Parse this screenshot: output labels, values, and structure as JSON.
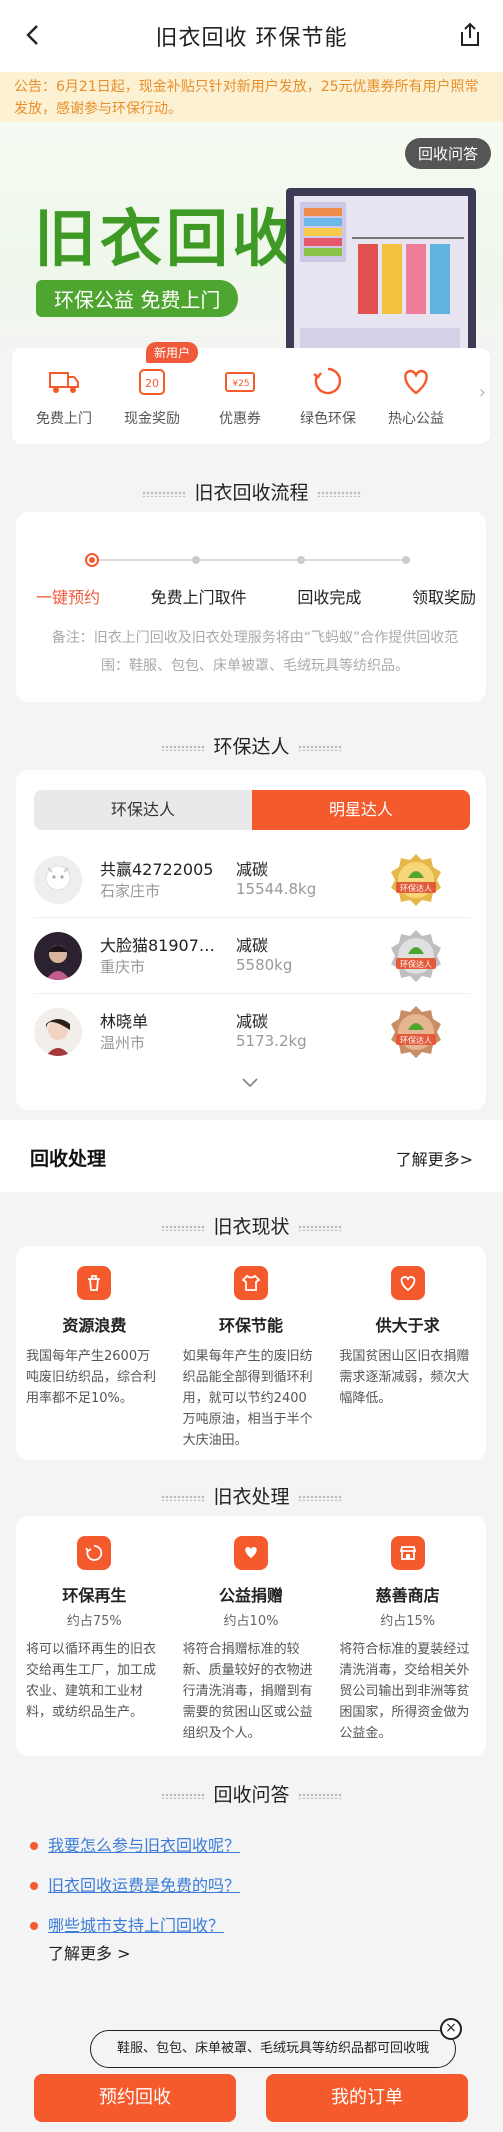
{
  "nav": {
    "title": "旧衣回收 环保节能",
    "back_icon": "chevron-left-icon",
    "share_icon": "share-icon"
  },
  "notice": "公告：6月21日起，现金补贴只针对新用户发放，25元优惠券所有用户照常发放，感谢参与环保行动。",
  "hero": {
    "faq_pill": "回收问答",
    "title": "旧衣回收",
    "subtitle": "环保公益 免费上门"
  },
  "services": {
    "new_badge": "新用户",
    "items": [
      {
        "label": "免费上门",
        "icon": "truck-icon"
      },
      {
        "label": "现金奖励",
        "icon": "cash-icon"
      },
      {
        "label": "优惠券",
        "icon": "coupon-icon"
      },
      {
        "label": "绿色环保",
        "icon": "recycle-icon"
      },
      {
        "label": "热心公益",
        "icon": "heart-icon"
      }
    ]
  },
  "flow": {
    "title": "旧衣回收流程",
    "steps": [
      "一键预约",
      "免费上门取件",
      "回收完成",
      "领取奖励"
    ],
    "note": "备注：旧衣上门回收及旧衣处理服务将由“飞蚂蚁”合作提供回收范围：鞋服、包包、床单被罩、毛绒玩具等纺织品。"
  },
  "eco": {
    "title": "环保达人",
    "tabs": [
      "环保达人",
      "明星达人"
    ],
    "carbon_label": "减碳",
    "medal_text": "环保达人",
    "users": [
      {
        "name": "共赢42722005",
        "city": "石家庄市",
        "carbon": "15544.8kg"
      },
      {
        "name": "大脸猫81907…",
        "city": "重庆市",
        "carbon": "5580kg"
      },
      {
        "name": "林晓单",
        "city": "温州市",
        "carbon": "5173.2kg"
      }
    ]
  },
  "recycle": {
    "heading": "回收处理",
    "more": "了解更多>"
  },
  "status": {
    "title": "旧衣现状",
    "items": [
      {
        "title": "资源浪费",
        "desc": "我国每年产生2600万吨废旧纺织品，综合利用率都不足10%。",
        "icon": "trash-icon"
      },
      {
        "title": "环保节能",
        "desc": "如果每年产生的废旧纺织品能全部得到循环利用，就可以节约2400万吨原油，相当于半个大庆油田。",
        "icon": "shirt-icon"
      },
      {
        "title": "供大于求",
        "desc": "我国贫困山区旧衣捐赠需求逐渐减弱，频次大幅降低。",
        "icon": "heart-hand-icon"
      }
    ]
  },
  "process": {
    "title": "旧衣处理",
    "items": [
      {
        "title": "环保再生",
        "pct": "约占75%",
        "desc": "将可以循环再生的旧衣交给再生工厂，加工成农业、建筑和工业材料，或纺织品生产。",
        "icon": "recycle-icon"
      },
      {
        "title": "公益捐赠",
        "pct": "约占10%",
        "desc": "将符合捐赠标准的较新、质量较好的衣物进行清洗消毒，捐赠到有需要的贫困山区或公益组织及个人。",
        "icon": "donate-icon"
      },
      {
        "title": "慈善商店",
        "pct": "约占15%",
        "desc": "将符合标准的夏装经过清洗消毒，交给相关外贸公司输出到非洲等贫困国家，所得资金做为公益金。",
        "icon": "shop-icon"
      }
    ]
  },
  "faq": {
    "title": "回收问答",
    "questions": [
      "我要怎么参与旧衣回收呢？",
      "旧衣回收运费是免费的吗？",
      "哪些城市支持上门回收？"
    ],
    "more": "了解更多 >"
  },
  "toast": "鞋服、包包、床单被罩、毛绒玩具等纺织品都可回收哦",
  "bottom": {
    "book": "预约回收",
    "orders": "我的订单"
  },
  "colors": {
    "accent": "#f45a2c",
    "green": "#3f9a25",
    "notice_text": "#e88f2a",
    "link": "#3b7dd8"
  }
}
